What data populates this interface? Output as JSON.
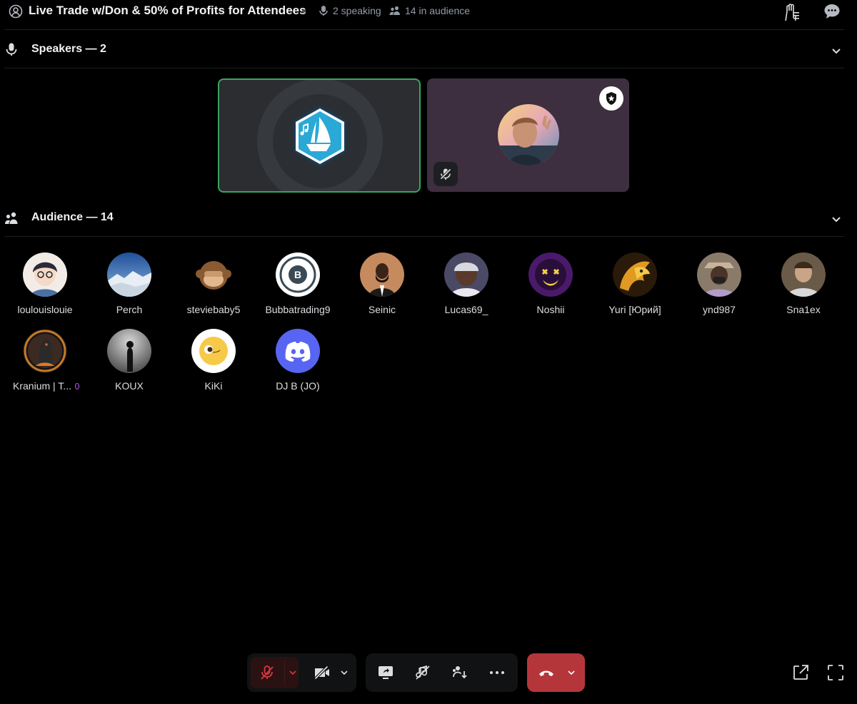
{
  "header": {
    "title": "Live Trade w/Don & 50% of Profits for Attendees",
    "speaking_label": "2 speaking",
    "audience_label": "14 in audience",
    "icons": [
      "stage-icon",
      "mic-icon",
      "people-icon",
      "raise-hand-icon",
      "chat-icon"
    ]
  },
  "speakers_section": {
    "title": "Speakers — 2",
    "speakers": [
      {
        "name": "boat-logo-speaker",
        "speaking": true,
        "ring_color": "#3ba55c"
      },
      {
        "name": "moderator-speaker",
        "muted": true,
        "moderator": true
      }
    ]
  },
  "audience_section": {
    "title": "Audience — 14",
    "members": [
      {
        "name": "loulouislouie",
        "color": "#f3ece6"
      },
      {
        "name": "Perch",
        "color": "#3a6fb0"
      },
      {
        "name": "steviebaby5",
        "color": "#000000"
      },
      {
        "name": "Bubbatrading9",
        "color": "#ffffff"
      },
      {
        "name": "Seinic",
        "color": "#c58a5e"
      },
      {
        "name": "Lucas69_",
        "color": "#5f5f7a"
      },
      {
        "name": "Noshii",
        "color": "#6b2e8f"
      },
      {
        "name": "Yuri [Юрий]",
        "color": "#d38b2a"
      },
      {
        "name": "ynd987",
        "color": "#9a8a7a"
      },
      {
        "name": "Sna1ex",
        "color": "#7a6a5a"
      },
      {
        "name": "Kranium | T...",
        "color": "#5a3a2a"
      },
      {
        "name": "KOUX",
        "color": "#6a6a6a"
      },
      {
        "name": "KiKi",
        "color": "#ffffff"
      },
      {
        "name": "DJ B (JO)",
        "color": "#5865f2"
      }
    ]
  },
  "controls": {
    "mic_muted": true,
    "accent_end_call": "#b5363a",
    "icons": [
      "mic-off-icon",
      "camera-off-icon",
      "screen-share-icon",
      "sound-off-icon",
      "move-to-audience-icon",
      "more-icon",
      "hang-up-icon",
      "popout-icon",
      "fullscreen-icon"
    ]
  }
}
